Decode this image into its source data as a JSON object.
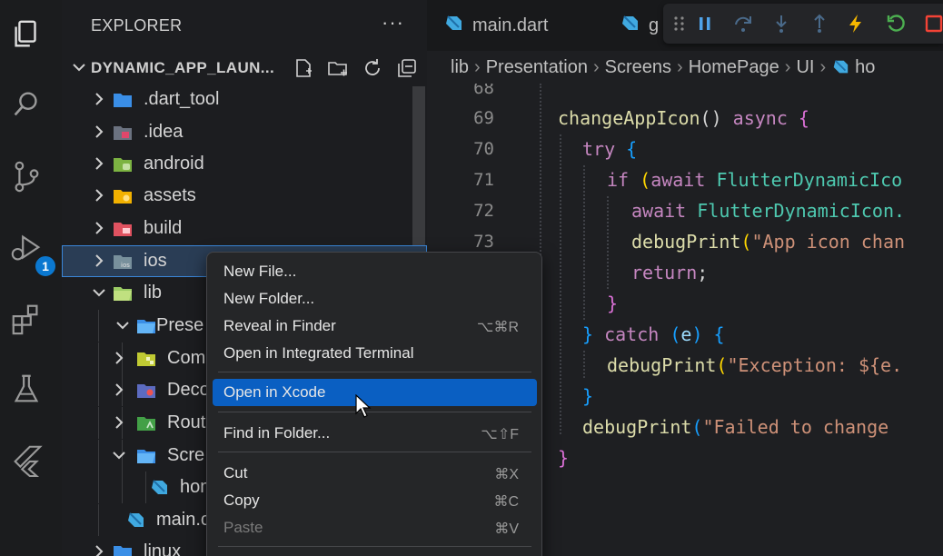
{
  "explorer": {
    "title": "EXPLORER",
    "more": "···",
    "root_label": "DYNAMIC_APP_LAUN...",
    "items": [
      {
        "label": ".dart_tool",
        "depth": 0,
        "icon": "folder-blue-icon"
      },
      {
        "label": ".idea",
        "depth": 0,
        "icon": "folder-idea-icon"
      },
      {
        "label": "android",
        "depth": 0,
        "icon": "folder-android-icon"
      },
      {
        "label": "assets",
        "depth": 0,
        "icon": "folder-assets-icon"
      },
      {
        "label": "build",
        "depth": 0,
        "icon": "folder-build-icon"
      },
      {
        "label": "ios",
        "depth": 0,
        "icon": "folder-ios-icon"
      },
      {
        "label": "lib",
        "depth": 0,
        "icon": "folder-lib-icon"
      },
      {
        "label": "Prese",
        "depth": 1,
        "icon": "folder-blue-icon"
      },
      {
        "label": "Comp",
        "depth": 2,
        "icon": "folder-components-icon"
      },
      {
        "label": "Deco",
        "depth": 2,
        "icon": "folder-decoration-icon"
      },
      {
        "label": "Rout",
        "depth": 2,
        "icon": "folder-routes-icon"
      },
      {
        "label": "Scre",
        "depth": 2,
        "icon": "folder-blue-icon"
      },
      {
        "label": "hom",
        "depth": 3,
        "icon": "dart-file-icon"
      },
      {
        "label": "main.c",
        "depth": 1,
        "icon": "dart-file-icon"
      },
      {
        "label": "linux",
        "depth": 0,
        "icon": "folder-blue-icon"
      }
    ],
    "ios_badge": "ios"
  },
  "activity": {
    "debug_badge": "1"
  },
  "tabs": [
    {
      "label": "main.dart"
    },
    {
      "label": "g"
    }
  ],
  "breadcrumb": [
    "lib",
    "Presentation",
    "Screens",
    "HomePage",
    "UI",
    "ho"
  ],
  "editor": {
    "line_numbers": [
      "68",
      "69",
      "70",
      "71",
      "72",
      "73"
    ],
    "lines": {
      "l69a": "changeAppIcon",
      "l69b": "() ",
      "l69c": "async",
      "l69d": " {",
      "l70a": "try",
      "l70b": " {",
      "l71a": "if",
      "l71b": " (",
      "l71c": "await",
      "l71d": " FlutterDynamicIco",
      "l72a": "await",
      "l72b": " FlutterDynamicIcon.",
      "l73a": "debugPrint",
      "l73b": "(",
      "l73c": "\"App icon chan",
      "l74a": "return",
      "l74b": ";",
      "l75a": "}",
      "l76a": "}",
      "l76b": " catch",
      "l76c": " (",
      "l76d": "e",
      "l76e": ") {",
      "l77a": "debugPrint",
      "l77b": "(",
      "l77c": "\"Exception: ${e.",
      "l78a": "}",
      "l79a": "debugPrint",
      "l79b": "(",
      "l79c": "\"Failed to change ",
      "l80a": "}"
    }
  },
  "context_menu": {
    "items": [
      {
        "label": "New File...",
        "shortcut": ""
      },
      {
        "label": "New Folder...",
        "shortcut": ""
      },
      {
        "label": "Reveal in Finder",
        "shortcut": "⌥⌘R"
      },
      {
        "label": "Open in Integrated Terminal",
        "shortcut": ""
      },
      {
        "label": "Open in Xcode",
        "shortcut": ""
      },
      {
        "label": "Find in Folder...",
        "shortcut": "⌥⇧F"
      },
      {
        "label": "Cut",
        "shortcut": "⌘X"
      },
      {
        "label": "Copy",
        "shortcut": "⌘C"
      },
      {
        "label": "Paste",
        "shortcut": "⌘V"
      }
    ]
  },
  "colors": {
    "accent": "#0a5fc2",
    "selection_outline": "#3a86d8",
    "dart_blue": "#40a9e0"
  }
}
